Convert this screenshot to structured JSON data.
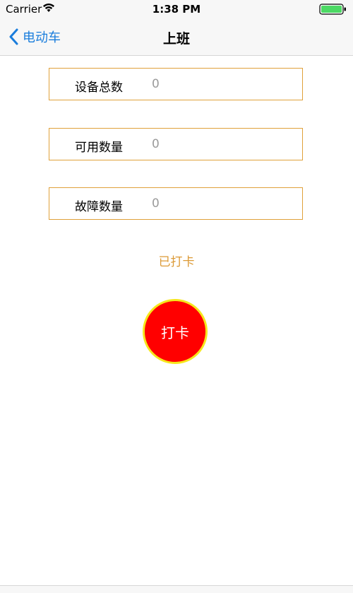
{
  "status_bar": {
    "carrier": "Carrier",
    "time": "1:38 PM",
    "icons": [
      "wifi-icon",
      "battery-icon"
    ]
  },
  "nav": {
    "back_label": "电动车",
    "title": "上班",
    "tint_color": "#1a7ddc"
  },
  "fields": [
    {
      "label": "设备总数",
      "value": "0"
    },
    {
      "label": "可用数量",
      "value": "0"
    },
    {
      "label": "故障数量",
      "value": "0"
    }
  ],
  "status_text": "已打卡",
  "punch_button": {
    "label": "打卡",
    "fill_color": "#ff0000",
    "border_color": "#f6e71c"
  },
  "colors": {
    "field_border": "#e0a13b",
    "status_text": "#dc9a36",
    "value_text": "#9b9b9b"
  }
}
